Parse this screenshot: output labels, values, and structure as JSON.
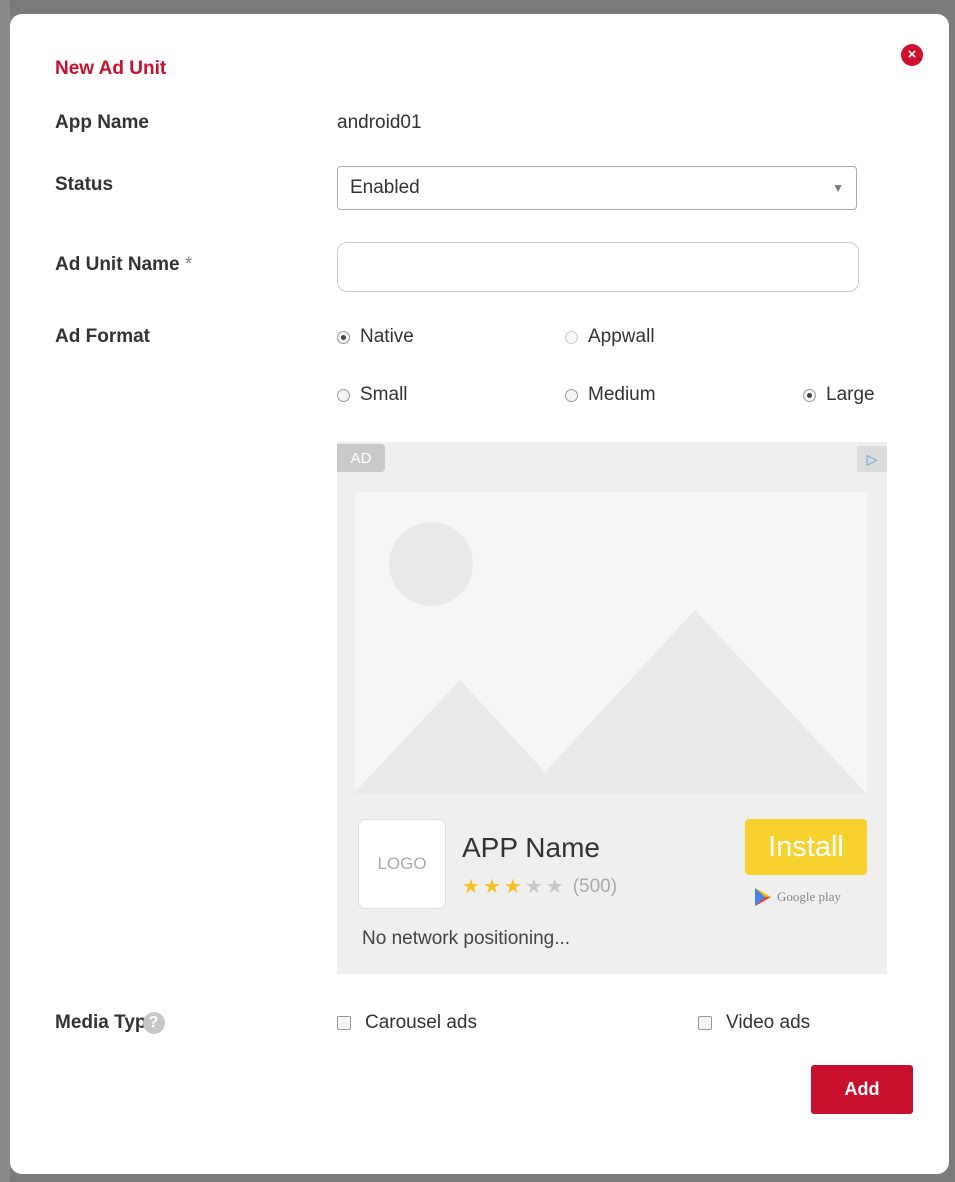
{
  "modal": {
    "title": "New Ad Unit",
    "close_icon": "close-icon"
  },
  "form": {
    "app_name_label": "App Name",
    "app_name_value": "android01",
    "status_label": "Status",
    "status_value": "Enabled",
    "ad_unit_name_label": "Ad Unit Name",
    "required_marker": "*",
    "ad_unit_name_value": "",
    "ad_format_label": "Ad Format",
    "ad_format_options": [
      {
        "label": "Native",
        "selected": true,
        "disabled": false
      },
      {
        "label": "Appwall",
        "selected": false,
        "disabled": true
      }
    ],
    "size_options": [
      {
        "label": "Small",
        "selected": false
      },
      {
        "label": "Medium",
        "selected": false
      },
      {
        "label": "Large",
        "selected": true
      }
    ],
    "media_type_label": "Media Typ",
    "help_glyph": "?",
    "media_options": [
      {
        "label": "Carousel ads",
        "checked": false
      },
      {
        "label": "Video ads",
        "checked": false
      }
    ],
    "add_label": "Add"
  },
  "ad_preview": {
    "ad_tag": "AD",
    "adchoices_icon": "adchoices-icon",
    "logo_text": "LOGO",
    "app_name": "APP Name",
    "rating_stars": 3,
    "rating_max": 5,
    "rating_count": "(500)",
    "install_label": "Install",
    "store_label": "Google play",
    "description": "No network positioning..."
  },
  "colors": {
    "accent": "#c8102e",
    "install": "#f7d22f",
    "star": "#f4c223"
  }
}
